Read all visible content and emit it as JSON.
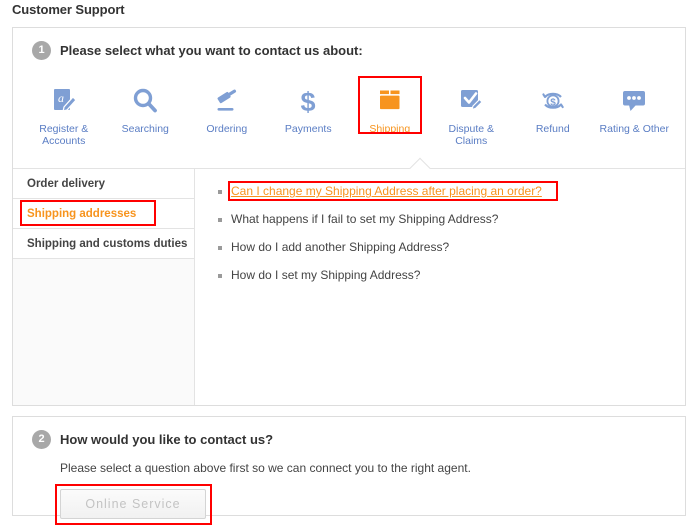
{
  "page": {
    "title": "Customer Support"
  },
  "step1": {
    "badge": "1",
    "title": "Please select what you want to contact us about:",
    "categories": [
      {
        "label": "Register & Accounts",
        "icon": "register-accounts-icon",
        "selected": false
      },
      {
        "label": "Searching",
        "icon": "search-icon",
        "selected": false
      },
      {
        "label": "Ordering",
        "icon": "gavel-icon",
        "selected": false
      },
      {
        "label": "Payments",
        "icon": "dollar-icon",
        "selected": false
      },
      {
        "label": "Shipping",
        "icon": "package-box-icon",
        "selected": true
      },
      {
        "label": "Dispute & Claims",
        "icon": "checklist-pencil-icon",
        "selected": false
      },
      {
        "label": "Refund",
        "icon": "refund-circle-dollar-icon",
        "selected": false
      },
      {
        "label": "Rating & Other",
        "icon": "chat-bubble-icon",
        "selected": false
      }
    ],
    "sidebar": [
      {
        "label": "Order delivery",
        "active": false,
        "highlighted": false
      },
      {
        "label": "Shipping addresses",
        "active": true,
        "highlighted": true
      },
      {
        "label": "Shipping and customs duties",
        "active": false,
        "highlighted": false
      }
    ],
    "questions": [
      {
        "text": "Can I change my Shipping Address after placing an order?",
        "highlighted": true
      },
      {
        "text": "What happens if I fail to set my Shipping Address?",
        "highlighted": false
      },
      {
        "text": "How do I add another Shipping Address?",
        "highlighted": false
      },
      {
        "text": "How do I set my Shipping Address?",
        "highlighted": false
      }
    ]
  },
  "step2": {
    "badge": "2",
    "title": "How would you like to contact us?",
    "note": "Please select a question above first so we can connect you to the right agent.",
    "button_label": "Online Service"
  },
  "colors": {
    "accent_orange": "#f7941e",
    "icon_blue": "#7f9fd4",
    "label_blue": "#5a7dc4",
    "annotation_red": "#ff0000",
    "text_dark": "#333333"
  }
}
